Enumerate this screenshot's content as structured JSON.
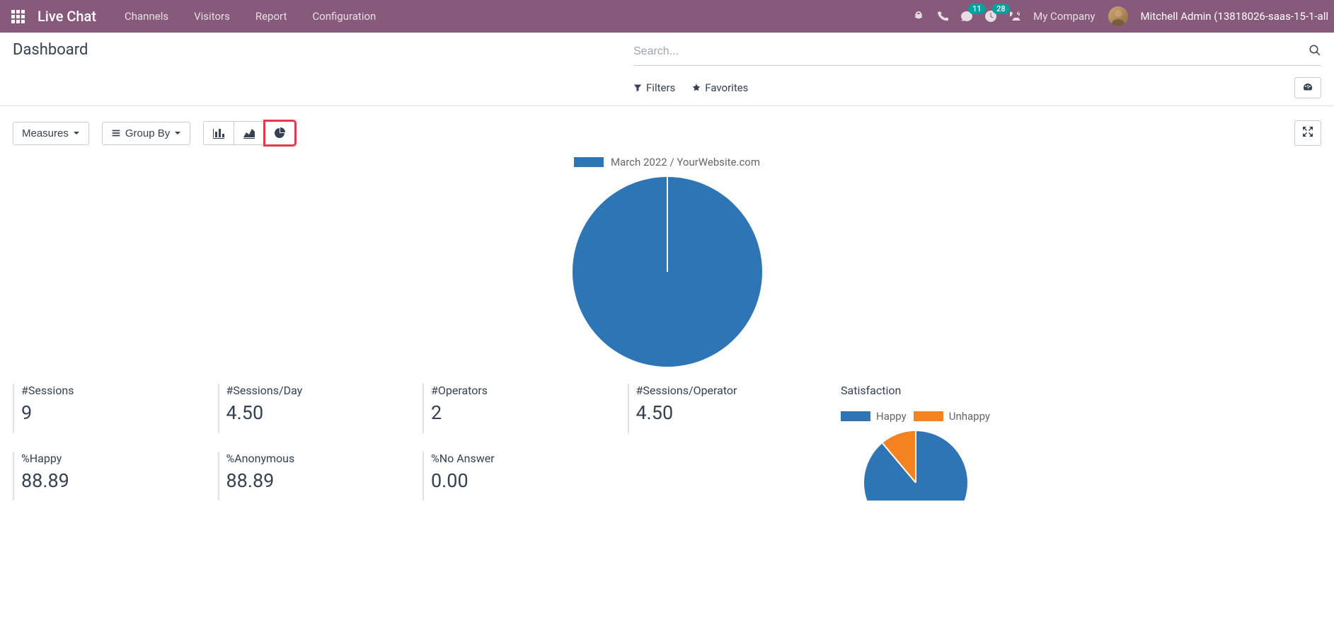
{
  "navbar": {
    "brand": "Live Chat",
    "menu": [
      "Channels",
      "Visitors",
      "Report",
      "Configuration"
    ],
    "badges": {
      "messages": "11",
      "activities": "28"
    },
    "company": "My Company",
    "user": "Mitchell Admin (13818026-saas-15-1-all"
  },
  "control": {
    "title": "Dashboard",
    "search_placeholder": "Search...",
    "filters_label": "Filters",
    "favorites_label": "Favorites"
  },
  "toolbar": {
    "measures_label": "Measures",
    "groupby_label": "Group By"
  },
  "chart_data": {
    "type": "pie",
    "series": [
      {
        "name": "March 2022 / YourWebsite.com",
        "value": 100,
        "color": "#2E75B6"
      }
    ],
    "title": "",
    "legend_position": "top"
  },
  "stats": [
    {
      "label": "#Sessions",
      "value": "9"
    },
    {
      "label": "#Sessions/Day",
      "value": "4.50"
    },
    {
      "label": "#Operators",
      "value": "2"
    },
    {
      "label": "#Sessions/Operator",
      "value": "4.50"
    },
    {
      "label": "%Happy",
      "value": "88.89"
    },
    {
      "label": "%Anonymous",
      "value": "88.89"
    },
    {
      "label": "%No Answer",
      "value": "0.00"
    }
  ],
  "satisfaction": {
    "title": "Satisfaction",
    "chart_data": {
      "type": "pie",
      "series": [
        {
          "name": "Happy",
          "value": 88.89,
          "color": "#2E75B6"
        },
        {
          "name": "Unhappy",
          "value": 11.11,
          "color": "#F58220"
        }
      ],
      "legend_position": "top"
    }
  }
}
